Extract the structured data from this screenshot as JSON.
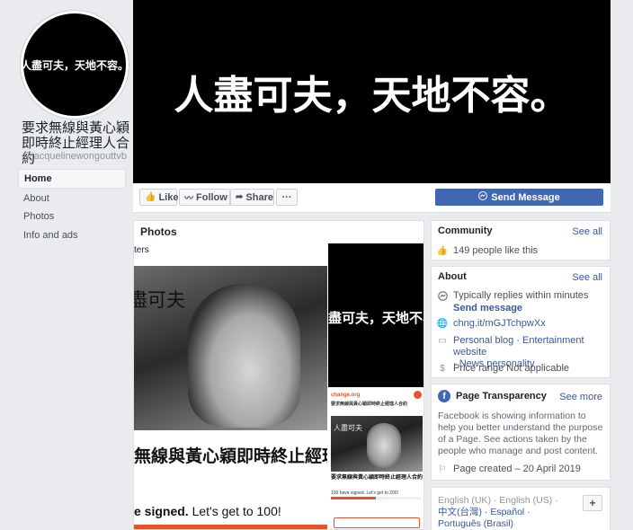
{
  "sidebar": {
    "avatar_text": "人盡可夫，天地不容。",
    "page_name": "要求無線與黃心穎即時終止經理人合約",
    "handle": "@jacquelinewongouttvb",
    "nav": [
      "Home",
      "About",
      "Photos",
      "Info and ads"
    ]
  },
  "cover": {
    "text": "人盡可夫，天地不容。"
  },
  "actions": {
    "like": "Like",
    "follow": "Follow",
    "share": "Share",
    "more": "···",
    "send_message": "Send Message"
  },
  "photos": {
    "title": "Photos",
    "main_top": "ters",
    "main_overlay": "盡可夫",
    "main_headline": "無線與黃心穎即時終止經理",
    "main_signed": "e signed.",
    "main_cta": "Let's get to 100!",
    "side_text": "盡可夫，天地不容",
    "side_site": "change.org",
    "side_title": "要求無線與黃心穎即時終止經理人合約",
    "side_overlay": "人盡可夫",
    "side_title2": "要求無線與黃心穎即時終止經理人合約",
    "side_signed": "100 have signed. Let's get to 200!"
  },
  "community": {
    "title": "Community",
    "see_all": "See all",
    "likes": "149 people like this"
  },
  "about": {
    "title": "About",
    "see_all": "See all",
    "replies": "Typically replies within minutes",
    "send_message": "Send message",
    "url": "chng.it/mGJTchpwXx",
    "categories_1": "Personal blog · Entertainment website",
    "categories_2": "· News personality",
    "price": "Price range Not applicable"
  },
  "transparency": {
    "title": "Page Transparency",
    "see_more": "See more",
    "desc": "Facebook is showing information to help you better understand the purpose of a Page. See actions taken by the people who manage and post content.",
    "created": "Page created – 20 April 2019"
  },
  "languages": {
    "line1": "English (UK) · English (US) ·",
    "line2": "中文(台灣) · Español ·",
    "line3": "Português (Brasil)",
    "plus": "+"
  }
}
